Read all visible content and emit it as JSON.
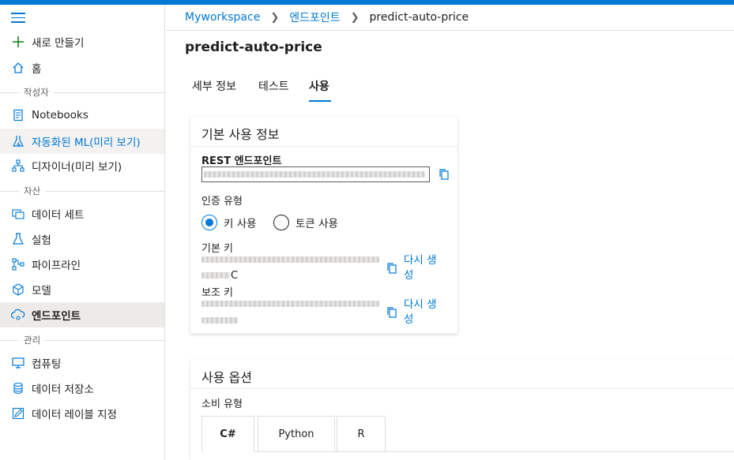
{
  "colors": {
    "accent": "#0078d4",
    "text": "#201f1e",
    "muted": "#605e5c"
  },
  "sidebar": {
    "new_label": "새로 만들기",
    "home_label": "홈",
    "section_author": "작성자",
    "notebooks_label": "Notebooks",
    "automl_label": "자동화된 ML(미리 보기)",
    "designer_label": "디자이너(미리 보기)",
    "section_assets": "자산",
    "datasets_label": "데이터 세트",
    "experiments_label": "실험",
    "pipelines_label": "파이프라인",
    "models_label": "모델",
    "endpoints_label": "엔드포인트",
    "section_manage": "관리",
    "compute_label": "컴퓨팅",
    "datastores_label": "데이터 저장소",
    "labeling_label": "데이터 레이블 지정"
  },
  "breadcrumb": {
    "workspace": "Myworkspace",
    "endpoints": "엔드포인트",
    "current": "predict-auto-price"
  },
  "page": {
    "title": "predict-auto-price"
  },
  "tabs": {
    "details": "세부 정보",
    "test": "테스트",
    "consume": "사용"
  },
  "basic_info": {
    "title": "기본 사용 정보",
    "rest_label": "REST 엔드포인트",
    "auth_label": "인증 유형",
    "auth_key": "키 사용",
    "auth_token": "토큰 사용",
    "primary_key_label": "기본 키",
    "primary_key_tail": "C",
    "secondary_key_label": "보조 키",
    "regenerate": "다시 생성"
  },
  "consume_options": {
    "title": "사용 옵션",
    "type_label": "소비 유형",
    "code_tabs": [
      "C#",
      "Python",
      "R"
    ]
  }
}
